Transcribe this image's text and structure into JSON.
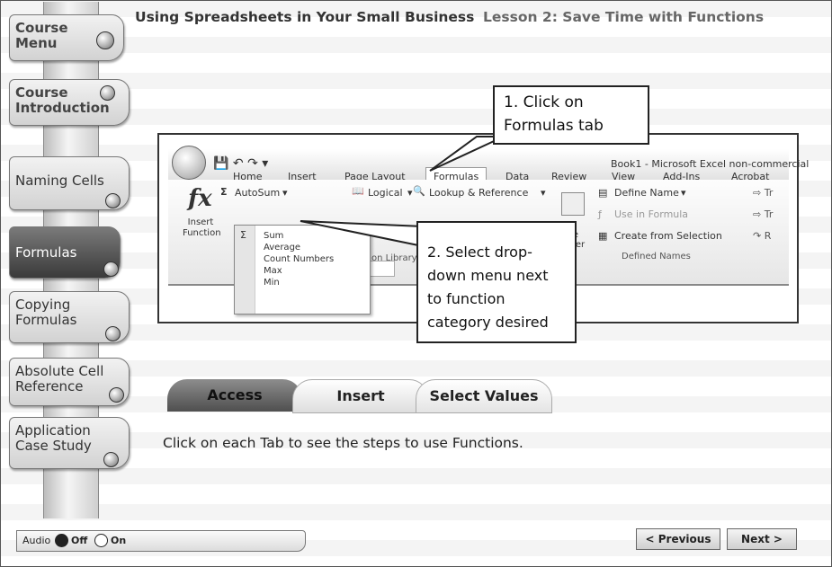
{
  "header": {
    "course_title": "Using Spreadsheets in Your Small Business",
    "lesson_title": "Lesson 2: Save Time with Functions"
  },
  "nav": {
    "items": [
      {
        "label": "Course Menu"
      },
      {
        "label": "Course Introduction"
      },
      {
        "label": "Naming Cells"
      },
      {
        "label": "Formulas"
      },
      {
        "label": "Copying Formulas"
      },
      {
        "label": "Absolute Cell Reference"
      },
      {
        "label": "Application Case Study"
      }
    ]
  },
  "excel": {
    "window_title": "Book1 - Microsoft Excel non-commercial",
    "ribbon_tabs": [
      "Home",
      "Insert",
      "Page Layout",
      "Formulas",
      "Data",
      "Review",
      "View",
      "Add-Ins",
      "Acrobat"
    ],
    "insert_function_label": "Insert Function",
    "autosum_label": "AutoSum",
    "logical_label": "Logical",
    "lookup_label": "Lookup & Reference",
    "define_name_label": "Define Name",
    "use_in_formula_label": "Use in Formula",
    "create_from_selection_label": "Create from Selection",
    "defined_names_label": "Defined Names",
    "name_manager_label": "ame nager",
    "function_library_label": "on Library",
    "dropdown_items": [
      "Sum",
      "Average",
      "Count Numbers",
      "Max",
      "Min"
    ]
  },
  "callouts": {
    "step1": "1. Click on Formulas tab",
    "step2": "2. Select drop-down menu next to function category desired"
  },
  "lesson_tabs": [
    "Access",
    "Insert",
    "Select Values"
  ],
  "instruction": "Click on each Tab to see the steps to use Functions.",
  "audio": {
    "label": "Audio",
    "off_label": "Off",
    "on_label": "On",
    "selected": "Off"
  },
  "buttons": {
    "previous": "< Previous",
    "next": "Next >"
  }
}
